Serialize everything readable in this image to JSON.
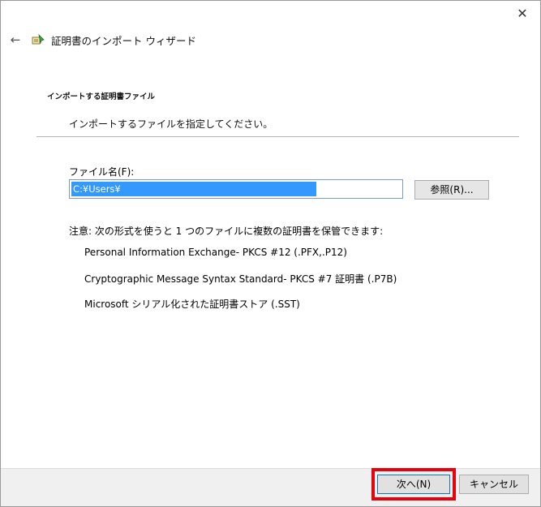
{
  "window": {
    "title": "証明書のインポート ウィザード"
  },
  "header": {
    "section_title": "インポートする証明書ファイル",
    "section_desc": "インポートするファイルを指定してください。"
  },
  "form": {
    "file_label": "ファイル名(F):",
    "file_value": "C:¥Users¥",
    "browse_label": "参照(R)..."
  },
  "note": {
    "text": "注意: 次の形式を使うと 1 つのファイルに複数の証明書を保管できます:",
    "formats": [
      "Personal Information Exchange- PKCS #12 (.PFX,.P12)",
      "Cryptographic Message Syntax Standard- PKCS #7 証明書 (.P7B)",
      "Microsoft シリアル化された証明書ストア (.SST)"
    ]
  },
  "footer": {
    "next_label": "次へ(N)",
    "cancel_label": "キャンセル"
  },
  "icons": {
    "close": "close-icon",
    "back": "back-arrow-icon",
    "wizard": "certificate-wizard-icon"
  },
  "colors": {
    "highlight": "#e8000b",
    "selection": "#3399ff"
  }
}
